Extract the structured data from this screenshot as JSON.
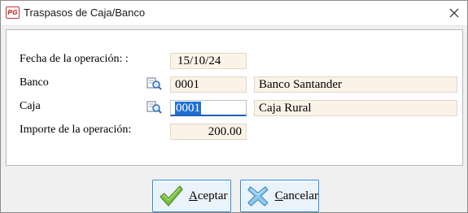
{
  "window": {
    "title": "Traspasos de Caja/Banco",
    "icon_text": "PG"
  },
  "form": {
    "fecha": {
      "label": "Fecha de la operación: :",
      "value": "15/10/24"
    },
    "banco": {
      "label": "Banco",
      "code": "0001",
      "name": "Banco Santander"
    },
    "caja": {
      "label": "Caja",
      "code": "0001",
      "name": "Caja Rural"
    },
    "importe": {
      "label": "Importe de la operación:",
      "value": "200.00"
    }
  },
  "buttons": {
    "aceptar": {
      "mnemonic": "A",
      "rest": "ceptar"
    },
    "cancelar": {
      "mnemonic": "C",
      "rest": "ancelar"
    }
  },
  "colors": {
    "field_bg": "#fbf3e8",
    "accent": "#1e5fb0",
    "selection": "#1f6fd6"
  }
}
